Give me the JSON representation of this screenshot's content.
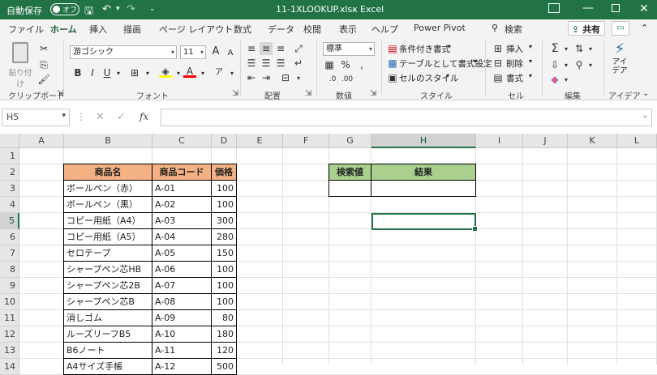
{
  "titlebar": {
    "autosave_label": "自動保存",
    "autosave_state": "オフ",
    "filename": "11-1XLOOKUP.xlsx",
    "separator": "-",
    "app": "Excel"
  },
  "tabs": [
    "ファイル",
    "ホーム",
    "挿入",
    "描画",
    "ページ レイアウト",
    "数式",
    "データ",
    "校閲",
    "表示",
    "ヘルプ",
    "Power Pivot",
    "検索"
  ],
  "share_label": "共有",
  "ribbon": {
    "clipboard": {
      "paste": "貼り付け",
      "label": "クリップボード"
    },
    "font": {
      "name": "游ゴシック",
      "size": "11",
      "bold": "B",
      "italic": "I",
      "underline": "U",
      "grow": "A",
      "shrink": "A",
      "label": "フォント"
    },
    "alignment": {
      "label": "配置"
    },
    "number": {
      "format": "標準",
      "label": "数値"
    },
    "styles": {
      "conditional": "条件付き書式",
      "table": "テーブルとして書式設定",
      "cell_style": "セルのスタイル",
      "label": "スタイル"
    },
    "cells": {
      "insert": "挿入",
      "delete": "削除",
      "format": "書式",
      "label": "セル"
    },
    "editing": {
      "label": "編集"
    },
    "ideas": {
      "button": "アイデア",
      "label": "アイデア"
    }
  },
  "formula_bar": {
    "name_box": "H5",
    "fx": "fx",
    "formula": ""
  },
  "columns": [
    "A",
    "B",
    "C",
    "D",
    "E",
    "F",
    "G",
    "H",
    "I",
    "J",
    "K",
    "L"
  ],
  "selected_column": "H",
  "rows": [
    "1",
    "2",
    "3",
    "4",
    "5",
    "6",
    "7",
    "8",
    "9",
    "10",
    "11",
    "12",
    "13",
    "14"
  ],
  "selected_row": "5",
  "table": {
    "headers": [
      "商品名",
      "商品コード",
      "価格"
    ],
    "rows": [
      [
        "ボールペン（赤）",
        "A-01",
        "100"
      ],
      [
        "ボールペン（黒）",
        "A-02",
        "100"
      ],
      [
        "コピー用紙（A4）",
        "A-03",
        "300"
      ],
      [
        "コピー用紙（A5）",
        "A-04",
        "280"
      ],
      [
        "セロテープ",
        "A-05",
        "150"
      ],
      [
        "シャープペン芯HB",
        "A-06",
        "100"
      ],
      [
        "シャープペン芯2B",
        "A-07",
        "100"
      ],
      [
        "シャープペン芯B",
        "A-08",
        "100"
      ],
      [
        "消しゴム",
        "A-09",
        "80"
      ],
      [
        "ルーズリーフB5",
        "A-10",
        "180"
      ],
      [
        "B6ノート",
        "A-11",
        "120"
      ],
      [
        "A4サイズ手帳",
        "A-12",
        "500"
      ]
    ]
  },
  "lookup": {
    "search_header": "検索値",
    "result_header": "結果",
    "search_value": "",
    "result_value": ""
  },
  "colors": {
    "excel_green": "#217346",
    "header_orange": "#f4b183",
    "header_green": "#a9d08e"
  }
}
